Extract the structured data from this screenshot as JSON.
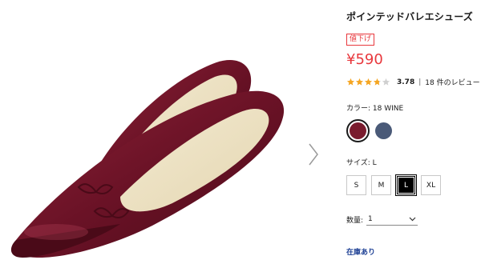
{
  "product": {
    "title": "ポインテッドバレエシューズ",
    "sale_badge": "値下げ",
    "price": "¥590",
    "rating": {
      "stars": 3.78,
      "value": "3.78",
      "separator": "|",
      "review_count": "18 件のレビュー",
      "star_color": "#f5a623"
    },
    "color": {
      "label": "カラー:",
      "selected": "18 WINE",
      "swatches": [
        {
          "name": "18 WINE",
          "hex": "#7a1c2e",
          "selected": true
        },
        {
          "name": "navy",
          "hex": "#4a5a78",
          "selected": false
        }
      ]
    },
    "size": {
      "label": "サイズ:",
      "selected": "L",
      "options": [
        "S",
        "M",
        "L",
        "XL"
      ]
    },
    "quantity": {
      "label": "数量:",
      "value": "1"
    },
    "stock_status": "在庫あり"
  },
  "colors": {
    "accent": "#e8383d",
    "link": "#1c3f94",
    "shoe": "#6e1428"
  },
  "icons": {
    "next": "chevron-right-icon",
    "dropdown": "chevron-down-icon"
  }
}
